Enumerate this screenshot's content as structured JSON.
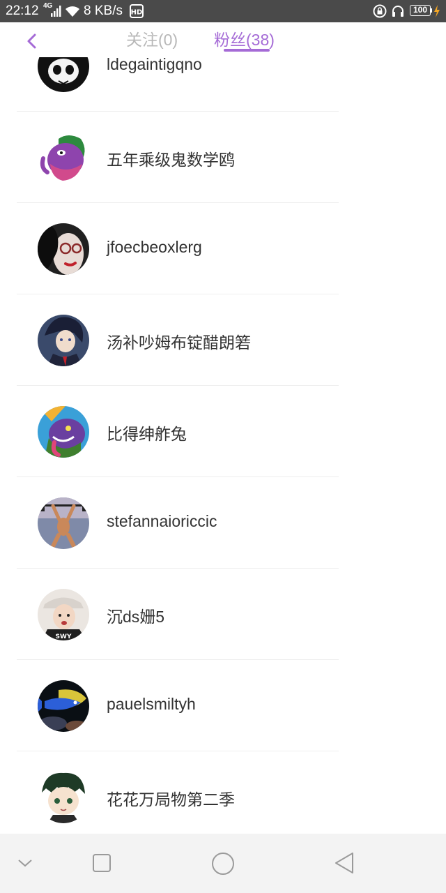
{
  "status_bar": {
    "time": "22:12",
    "network": "4G",
    "speed": "8 KB/s",
    "battery": "100"
  },
  "header": {
    "tabs": [
      {
        "label": "关注(0)",
        "active": false
      },
      {
        "label": "粉丝(38)",
        "active": true
      }
    ],
    "accent_color": "#a56bd6"
  },
  "fans": [
    {
      "name": "ldegaintigqno",
      "avatar": "panda-avatar"
    },
    {
      "name": "五年乘级鬼数学鸥",
      "avatar": "purple-monster-avatar"
    },
    {
      "name": "jfoecbeoxlerg",
      "avatar": "glasses-girl-avatar"
    },
    {
      "name": "汤补吵姆布锭醋朗箬",
      "avatar": "anime-boy-avatar"
    },
    {
      "name": "比得绅舴兔",
      "avatar": "cartoon-beast-avatar"
    },
    {
      "name": "stefannaioriccic",
      "avatar": "weightlifter-avatar"
    },
    {
      "name": "沉ds姗5",
      "avatar": "cap-girl-avatar"
    },
    {
      "name": "pauelsmiltyh",
      "avatar": "tropical-fish-avatar"
    },
    {
      "name": "花花万局物第二季",
      "avatar": "chibi-character-avatar"
    }
  ]
}
